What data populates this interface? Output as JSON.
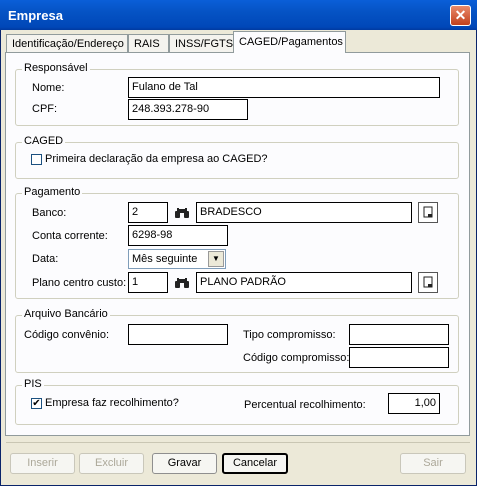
{
  "window": {
    "title": "Empresa",
    "close": "✕"
  },
  "tabs": [
    "Identificação/Endereço",
    "RAIS",
    "INSS/FGTS",
    "CAGED/Pagamentos"
  ],
  "responsavel": {
    "legend": "Responsável",
    "nome_label": "Nome:",
    "nome_value": "Fulano de Tal",
    "cpf_label": "CPF:",
    "cpf_value": "248.393.278-90"
  },
  "caged": {
    "legend": "CAGED",
    "checkbox_label": "Primeira declaração da empresa ao CAGED?",
    "checked": false
  },
  "pagamento": {
    "legend": "Pagamento",
    "banco_label": "Banco:",
    "banco_code": "2",
    "banco_name": "BRADESCO",
    "conta_label": "Conta corrente:",
    "conta_value": "6298-98",
    "data_label": "Data:",
    "data_value": "Mês seguinte",
    "plano_label": "Plano centro custo:",
    "plano_code": "1",
    "plano_name": "PLANO PADRÃO"
  },
  "arquivo": {
    "legend": "Arquivo Bancário",
    "convenio_label": "Código convênio:",
    "tipo_label": "Tipo compromisso:",
    "codigo_label": "Código compromisso:"
  },
  "pis": {
    "legend": "PIS",
    "checkbox_label": "Empresa faz recolhimento?",
    "checked": true,
    "percentual_label": "Percentual recolhimento:",
    "percentual_value": "1,00"
  },
  "buttons": {
    "inserir": "Inserir",
    "excluir": "Excluir",
    "gravar": "Gravar",
    "cancelar": "Cancelar",
    "sair": "Sair"
  },
  "icons": {
    "lookup": "binoculars-icon",
    "browse": "document-icon",
    "dropdown": "chevron-down-icon",
    "check": "✔"
  }
}
